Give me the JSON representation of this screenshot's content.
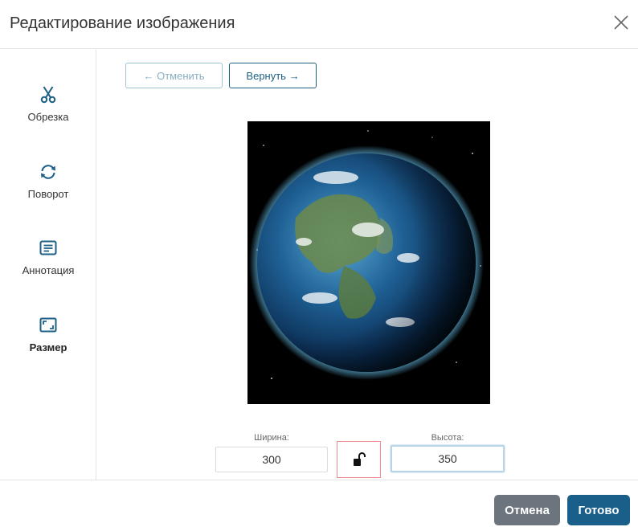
{
  "dialog": {
    "title": "Редактирование изображения"
  },
  "sidebar": {
    "items": [
      {
        "label": "Обрезка",
        "icon": "scissors-icon"
      },
      {
        "label": "Поворот",
        "icon": "rotate-icon"
      },
      {
        "label": "Аннотация",
        "icon": "annotation-icon"
      },
      {
        "label": "Размер",
        "icon": "resize-icon",
        "active": true
      }
    ]
  },
  "toolbar": {
    "undo_label": "← Отменить",
    "redo_label": "Вернуть →"
  },
  "resize": {
    "width_label": "Ширина:",
    "width_value": "300",
    "height_label": "Высота:",
    "height_value": "350",
    "aspect_lock": "unlocked"
  },
  "footer": {
    "cancel_label": "Отмена",
    "done_label": "Готово"
  },
  "colors": {
    "accent": "#1a5f8a",
    "secondary": "#6c757d",
    "sidebar_icon": "#1d5f86",
    "lock_highlight": "#f28b8b"
  }
}
